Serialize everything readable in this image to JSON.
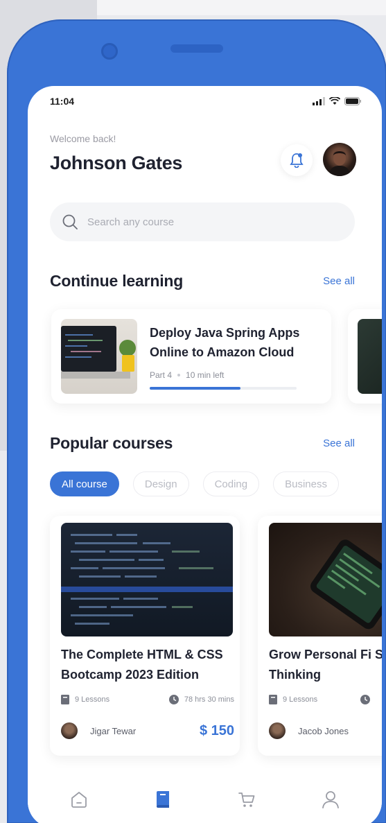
{
  "status_bar": {
    "time": "11:04"
  },
  "header": {
    "welcome": "Welcome back!",
    "user_name": "Johnson Gates"
  },
  "search": {
    "placeholder": "Search any course",
    "value": ""
  },
  "continue_learning": {
    "title": "Continue learning",
    "see_all": "See all",
    "items": [
      {
        "title": "Deploy Java Spring Apps Online to Amazon Cloud",
        "part": "Part 4",
        "time_left": "10 min left",
        "progress": 0.62
      }
    ]
  },
  "popular_courses": {
    "title": "Popular courses",
    "see_all": "See all",
    "filters": [
      "All course",
      "Design",
      "Coding",
      "Business"
    ],
    "active_filter": "All course",
    "items": [
      {
        "title": "The Complete HTML & CSS Bootcamp 2023 Edition",
        "lessons": "9 Lessons",
        "duration": "78 hrs 30 mins",
        "author": "Jigar Tewar",
        "price": "$ 150"
      },
      {
        "title": "Grow Personal Fi Security Thinking",
        "lessons": "9 Lessons",
        "duration": "",
        "author": "Jacob Jones",
        "price": ""
      }
    ]
  },
  "colors": {
    "accent": "#3a74d6",
    "frame": "#3a74d6",
    "text_dark": "#1f2230",
    "text_muted": "#9a9aa3"
  },
  "nav": {
    "items": [
      "home-icon",
      "book-icon",
      "cart-icon",
      "profile-icon"
    ],
    "active": "book-icon"
  }
}
